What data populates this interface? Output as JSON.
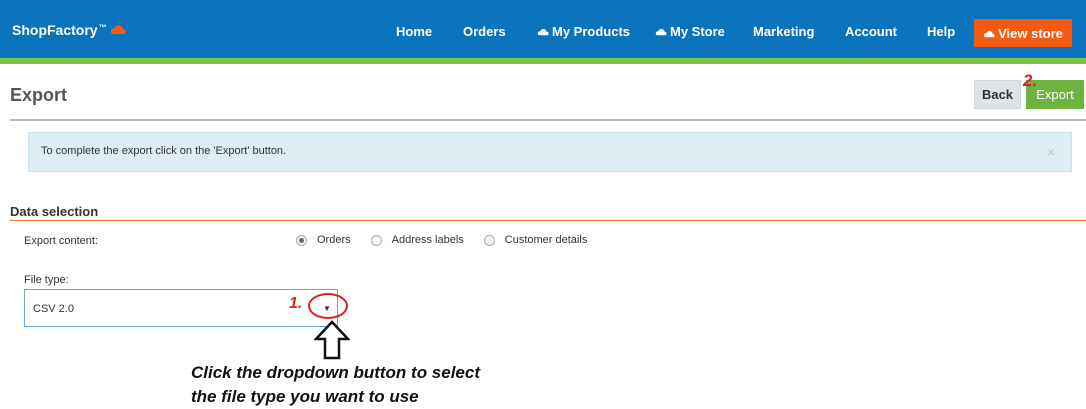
{
  "brand": {
    "name": "ShopFactory",
    "tm": "™"
  },
  "nav": {
    "home": "Home",
    "orders": "Orders",
    "my_products": "My Products",
    "my_store": "My Store",
    "marketing": "Marketing",
    "account": "Account",
    "help": "Help",
    "view_store": "View store"
  },
  "page": {
    "title": "Export",
    "back_label": "Back",
    "export_label": "Export",
    "step2_marker": "2."
  },
  "alert": {
    "text": "To complete the export click on the 'Export' button.",
    "close": "×"
  },
  "data_selection": {
    "title": "Data selection",
    "export_content_label": "Export content:",
    "options": [
      "Orders",
      "Address labels",
      "Customer details"
    ],
    "selected": "Orders",
    "file_type_label": "File type:",
    "file_type_value": "CSV 2.0",
    "step1_marker": "1."
  },
  "annotation": {
    "line1": "Click the dropdown button to select",
    "line2": "the file type you want to use"
  },
  "colors": {
    "topbar": "#0a73bb",
    "accent_green": "#7dc242",
    "view_store_orange": "#f55a12",
    "export_green": "#6db33f",
    "annotation_red": "#e02020"
  }
}
